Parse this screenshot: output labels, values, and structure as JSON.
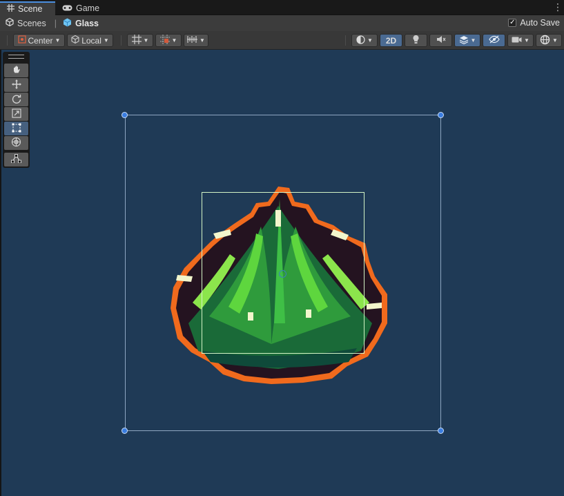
{
  "tabs": [
    {
      "label": "Scene",
      "icon": "grid-icon",
      "active": true
    },
    {
      "label": "Game",
      "icon": "gamepad-icon",
      "active": false
    }
  ],
  "breadcrumb": {
    "root": "Scenes",
    "current": "Glass"
  },
  "autosave": {
    "label": "Auto Save",
    "checked": true
  },
  "toolbar": {
    "pivot_mode": "Center",
    "pivot_rotation": "Local",
    "mode_2d": "2D"
  },
  "tools": [
    "hand-tool",
    "move-tool",
    "rotate-tool",
    "scale-tool",
    "rect-tool",
    "transform-tool",
    "custom-tool"
  ],
  "active_tool": "rect-tool",
  "colors": {
    "viewport": "#1f3a56",
    "outline": "#f06a1d",
    "selection_handle": "#3a7de0",
    "sprite_bounds": "#d4f5c6"
  }
}
